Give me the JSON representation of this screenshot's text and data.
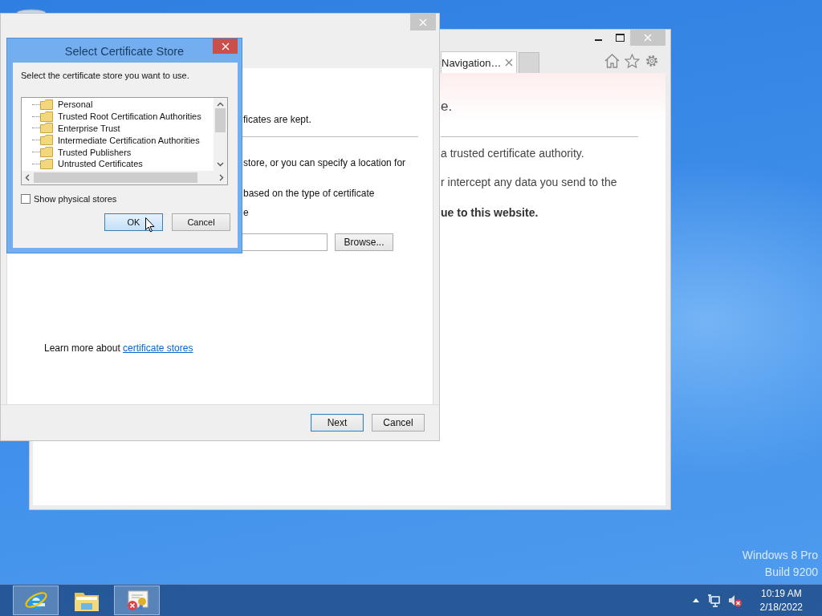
{
  "browser_window": {
    "tabs": [
      {
        "label": "Navigation…",
        "selected": true
      }
    ],
    "page": {
      "heading": "e.",
      "paragraphs": [
        {
          "text": "a trusted certificate authority.",
          "bold": false
        },
        {
          "text": "r intercept any data you send to the",
          "bold": false
        },
        {
          "text": "ue to this website.",
          "bold": true
        }
      ]
    }
  },
  "wizard_window": {
    "lines": [
      "ficates are kept.",
      "store, or you can specify a location for",
      "based on the type of certificate",
      "e"
    ],
    "browse_button": "Browse...",
    "learn_more": {
      "text": "Learn more about",
      "link": "certificate stores"
    },
    "buttons": [
      {
        "label": "Next",
        "default": true
      },
      {
        "label": "Cancel",
        "default": false
      }
    ]
  },
  "dialog": {
    "title": "Select Certificate Store",
    "instruction": "Select the certificate store you want to use.",
    "stores": [
      {
        "label": "Personal",
        "selected": false
      },
      {
        "label": "Trusted Root Certification Authorities",
        "selected": false
      },
      {
        "label": "Enterprise Trust",
        "selected": false
      },
      {
        "label": "Intermediate Certification Authorities",
        "selected": false
      },
      {
        "label": "Trusted Publishers",
        "selected": false
      },
      {
        "label": "Untrusted Certificates",
        "selected": false
      }
    ],
    "show_physical_stores": {
      "label": "Show physical stores",
      "checked": false
    },
    "buttons": [
      {
        "label": "OK",
        "default": true
      },
      {
        "label": "Cancel",
        "default": false
      }
    ]
  },
  "edition": [
    "Windows 8 Pro",
    "Build 9200"
  ],
  "taskbar": {
    "apps": [
      {
        "kind": "browser",
        "running": true
      },
      {
        "kind": "folder",
        "running": false
      },
      {
        "kind": "certificate",
        "running": true
      }
    ],
    "clock": {
      "time": "10:19 AM",
      "date": "2/18/2022"
    }
  }
}
